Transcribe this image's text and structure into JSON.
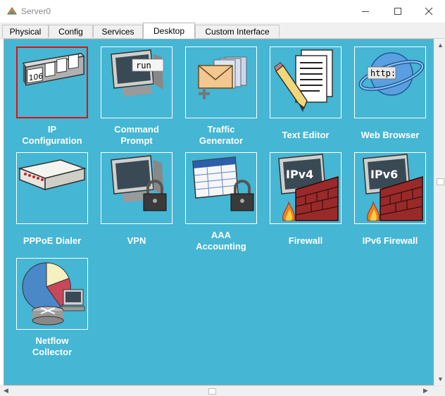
{
  "window": {
    "title": "Server0",
    "app_icon": "packet-tracer-icon"
  },
  "tabs": [
    {
      "label": "Physical",
      "active": false
    },
    {
      "label": "Config",
      "active": false
    },
    {
      "label": "Services",
      "active": false
    },
    {
      "label": "Desktop",
      "active": true
    },
    {
      "label": "Custom Interface",
      "active": false
    }
  ],
  "apps": [
    {
      "label": "IP\nConfiguration",
      "icon": "ip-configuration-icon",
      "icon_text": "106",
      "selected": true
    },
    {
      "label": "Command\nPrompt",
      "icon": "command-prompt-icon",
      "icon_text": "run",
      "selected": false
    },
    {
      "label": "Traffic\nGenerator",
      "icon": "traffic-generator-icon",
      "selected": false
    },
    {
      "label": "Text Editor",
      "icon": "text-editor-icon",
      "selected": false
    },
    {
      "label": "Web Browser",
      "icon": "web-browser-icon",
      "icon_text": "http:",
      "selected": false
    },
    {
      "label": "PPPoE Dialer",
      "icon": "pppoe-dialer-icon",
      "selected": false
    },
    {
      "label": "VPN",
      "icon": "vpn-icon",
      "selected": false
    },
    {
      "label": "AAA\nAccounting",
      "icon": "aaa-accounting-icon",
      "selected": false
    },
    {
      "label": "Firewall",
      "icon": "firewall-icon",
      "icon_text": "IPv4",
      "selected": false
    },
    {
      "label": "IPv6 Firewall",
      "icon": "ipv6-firewall-icon",
      "icon_text": "IPv6",
      "selected": false
    },
    {
      "label": "Netflow\nCollector",
      "icon": "netflow-collector-icon",
      "selected": false
    }
  ],
  "colors": {
    "desktop_bg": "#45b6d3",
    "selected_border": "#e01010",
    "label_text": "#ffffff"
  }
}
